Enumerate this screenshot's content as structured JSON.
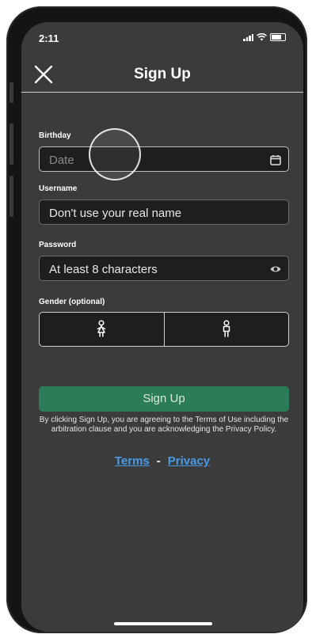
{
  "status_bar": {
    "time": "2:11"
  },
  "header": {
    "title": "Sign Up",
    "close_icon": "close-icon"
  },
  "form": {
    "birthday": {
      "label": "Birthday",
      "placeholder": "Date",
      "icon": "calendar-icon"
    },
    "username": {
      "label": "Username",
      "placeholder": "Don't use your real name"
    },
    "password": {
      "label": "Password",
      "placeholder": "At least 8 characters",
      "icon": "eye-icon"
    },
    "gender": {
      "label": "Gender (optional)",
      "options": [
        {
          "icon": "female-icon"
        },
        {
          "icon": "male-icon"
        }
      ]
    }
  },
  "signup_button": {
    "label": "Sign Up",
    "color": "#2a7d58"
  },
  "legal_text": "By clicking Sign Up, you are agreeing to the Terms of Use including the arbitration clause and you are acknowledging the Privacy Policy.",
  "links": {
    "terms": "Terms",
    "separator": "-",
    "privacy": "Privacy",
    "color": "#4a9be8"
  }
}
